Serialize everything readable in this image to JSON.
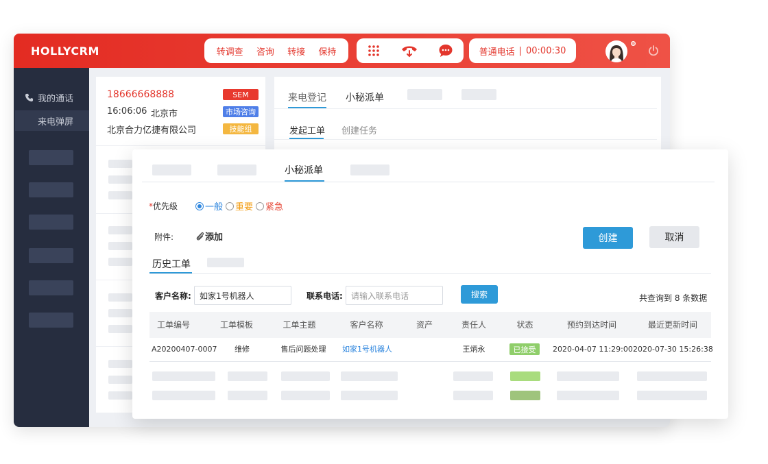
{
  "app": {
    "brand": "HOLLYCRM"
  },
  "toolbar": {
    "actions": [
      "转调查",
      "咨询",
      "转接",
      "保持"
    ],
    "call_status": "普通电话",
    "timer": "00:00:30"
  },
  "sidebar": {
    "items": [
      {
        "label": "我的通话",
        "icon": "phone-icon"
      },
      {
        "label": "来电弹屏"
      }
    ]
  },
  "caller": {
    "phone": "18666668888",
    "time": "16:06:06",
    "city": "北京市",
    "company": "北京合力亿捷有限公司",
    "tags": [
      {
        "label": "SEM",
        "color": "#e8392e"
      },
      {
        "label": "市场咨询",
        "color": "#4f7fe8"
      },
      {
        "label": "技能组",
        "color": "#f4b740"
      }
    ]
  },
  "main_tabs": {
    "tabs": [
      "来电登记",
      "小秘派单"
    ],
    "sub_tabs": [
      "发起工单",
      "创建任务"
    ]
  },
  "dialog": {
    "active_tab": "小秘派单",
    "priority": {
      "label": "优先级",
      "required_mark": "*",
      "options": [
        {
          "label": "一般",
          "color": "#2e86de",
          "selected": true
        },
        {
          "label": "重要",
          "color": "#f39c12",
          "selected": false
        },
        {
          "label": "紧急",
          "color": "#e74c3c",
          "selected": false
        }
      ]
    },
    "attachment": {
      "label": "附件:",
      "add": "添加"
    },
    "create_button": "创建",
    "cancel_button": "取消",
    "history_tab": "历史工单",
    "search": {
      "customer_label": "客户名称:",
      "customer_value": "如家1号机器人",
      "phone_label": "联系电话:",
      "phone_placeholder": "请输入联系电话",
      "button": "搜索",
      "result_text": "共查询到 8 条数据"
    },
    "table": {
      "columns": [
        "工单编号",
        "工单模板",
        "工单主题",
        "客户名称",
        "资产",
        "责任人",
        "状态",
        "预约到达时间",
        "最近更新时间"
      ],
      "rows": [
        {
          "id": "A20200407-0007",
          "template": "维修",
          "subject": "售后问题处理",
          "customer": "如家1号机器人",
          "asset": "",
          "owner": "王炳永",
          "status": "已接受",
          "appointment": "2020-04-07 11:29:00",
          "updated": "2020-07-30 15:26:38"
        }
      ],
      "status_color": "#8fce6a"
    }
  }
}
